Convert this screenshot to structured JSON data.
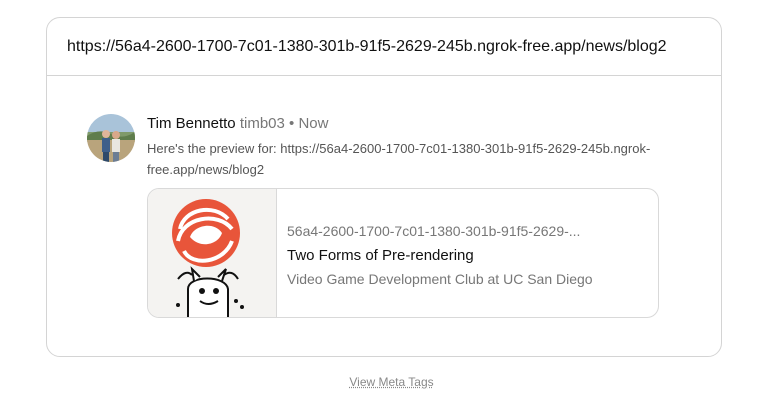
{
  "url_bar": {
    "url": "https://56a4-2600-1700-7c01-1380-301b-91f5-2629-245b.ngrok-free.app/news/blog2"
  },
  "post": {
    "author": "Tim Bennetto",
    "handle": "timb03",
    "separator": "•",
    "time": "Now",
    "message": "Here's the preview for: https://56a4-2600-1700-7c01-1380-301b-91f5-2629-245b.ngrok-free.app/news/blog2"
  },
  "preview": {
    "domain": "56a4-2600-1700-7c01-1380-301b-91f5-2629-...",
    "title": "Two Forms of Pre-rendering",
    "site": "Video Game Development Club at UC San Diego",
    "thumb_accent": "#e8553a"
  },
  "footer": {
    "meta_link": "View Meta Tags"
  }
}
